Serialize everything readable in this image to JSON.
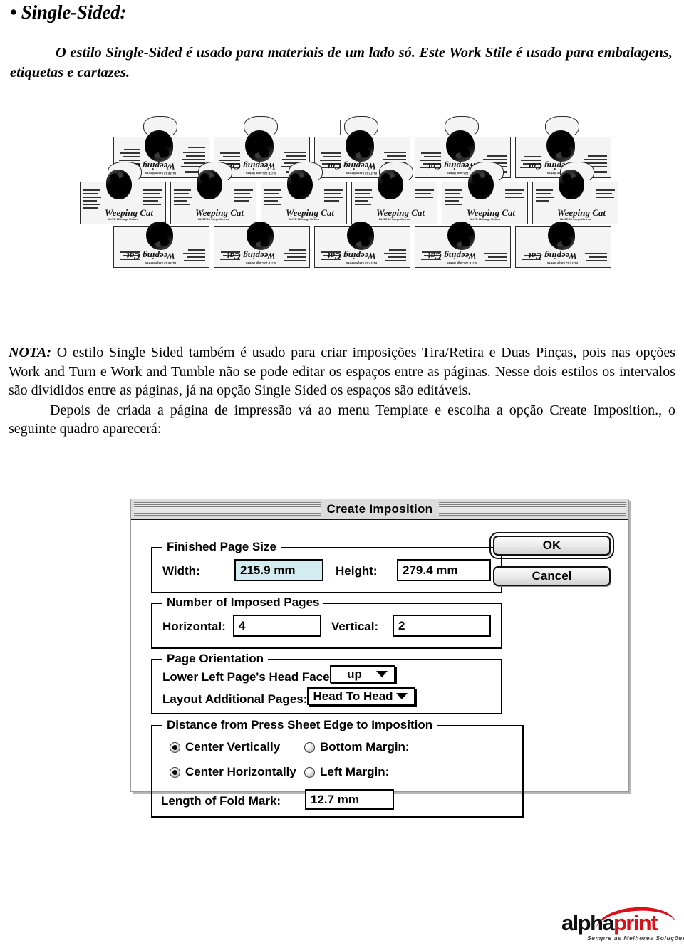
{
  "document": {
    "heading": "• Single-Sided:",
    "intro": "O estilo Single-Sided é usado para materiais de um lado só. Este Work Stile é usado para embalagens, etiquetas e cartazes.",
    "note_label": "NOTA:",
    "note_paragraph_1": " O estilo Single Sided também é usado para criar imposições Tira/Retira e Duas Pinças, pois nas opções Work and Turn e Work and Tumble não se pode editar os espaços entre as páginas. Nesse dois estilos os intervalos são divididos entre as páginas, já na opção Single Sided os espaços são editáveis.",
    "note_paragraph_2": "Depois de criada a página de impressão vá ao menu Template e escolha a opção Create Imposition., o seguinte quadro aparecerá:"
  },
  "imposition_figure": {
    "caption": "",
    "label_brand": "Weeping Cat",
    "label_subtitle": "BLITE 12 Large Metres",
    "rows": 3,
    "labels_top_row": 5,
    "labels_middle_row": 6,
    "labels_bottom_row": 5
  },
  "dialog": {
    "title": "Create Imposition",
    "groups": {
      "finished_page_size": {
        "legend": "Finished Page Size",
        "width_label": "Width:",
        "width_value": "215.9 mm",
        "height_label": "Height:",
        "height_value": "279.4 mm"
      },
      "number_of_imposed_pages": {
        "legend": "Number of Imposed Pages",
        "horizontal_label": "Horizontal:",
        "horizontal_value": "4",
        "vertical_label": "Vertical:",
        "vertical_value": "2"
      },
      "page_orientation": {
        "legend": "Page Orientation",
        "head_faces_label": "Lower Left Page's Head Faces:",
        "head_faces_value": "up",
        "layout_additional_label": "Layout Additional Pages:",
        "layout_additional_value": "Head To Head"
      },
      "distance": {
        "legend": "Distance from Press Sheet Edge to Imposition",
        "center_vertically": "Center Vertically",
        "bottom_margin": "Bottom Margin:",
        "center_horizontally": "Center Horizontally",
        "left_margin": "Left Margin:",
        "fold_mark_label": "Length of Fold Mark:",
        "fold_mark_value": "12.7 mm"
      }
    },
    "buttons": {
      "ok": "OK",
      "cancel": "Cancel"
    },
    "colors": {
      "selected_field_background": "#d3ecef",
      "titlebar_background": "#dcdcdc"
    }
  },
  "footer": {
    "logo_alpha": "alpha",
    "logo_print": "print",
    "logo_tagline": "Sempre as Melhores Soluções",
    "brand_red": "#d8111a"
  }
}
